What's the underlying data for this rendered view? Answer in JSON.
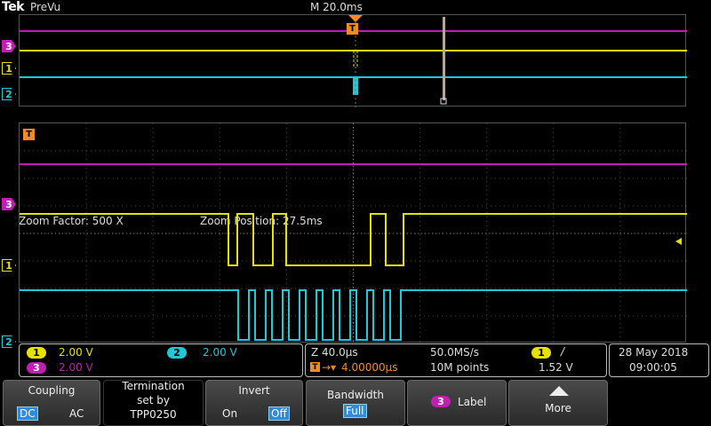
{
  "header": {
    "logo": "Tek",
    "mode": "PreVu",
    "timebase": "M 20.0ms"
  },
  "zoom": {
    "factor": "Zoom Factor: 500 X",
    "position": "Zoom Position: 27.5ms"
  },
  "channels": {
    "ch3": {
      "label": "3",
      "color": "#c01fb4"
    },
    "ch1": {
      "label": "1",
      "color": "#e8e000"
    },
    "ch2": {
      "label": "2",
      "color": "#1ec8d8"
    },
    "trigger_marker": "T"
  },
  "readouts": {
    "ch1_num": "1",
    "ch1_scale": "2.00 V",
    "ch2_num": "2",
    "ch2_scale": "2.00 V",
    "ch3_num": "3",
    "ch3_scale": "2.00 V",
    "zoom_scale": "Z 40.0µs",
    "sample_rate": "50.0MS/s",
    "trig_delay": "4.00000µs",
    "record_length": "10M points",
    "trig_source": "1",
    "trig_slope": "/",
    "trig_level": "1.52 V",
    "date": "28 May  2018",
    "time": "09:00:05"
  },
  "softkeys": {
    "coupling": {
      "title": "Coupling",
      "opt_dc": "DC",
      "opt_ac": "AC"
    },
    "termination": {
      "line1": "Termination",
      "line2": "set by",
      "line3": "TPP0250"
    },
    "invert": {
      "title": "Invert",
      "opt_on": "On",
      "opt_off": "Off"
    },
    "bandwidth": {
      "title": "Bandwidth",
      "value": "Full"
    },
    "label": {
      "num": "3",
      "title": "Label"
    },
    "more": {
      "title": "More"
    }
  }
}
